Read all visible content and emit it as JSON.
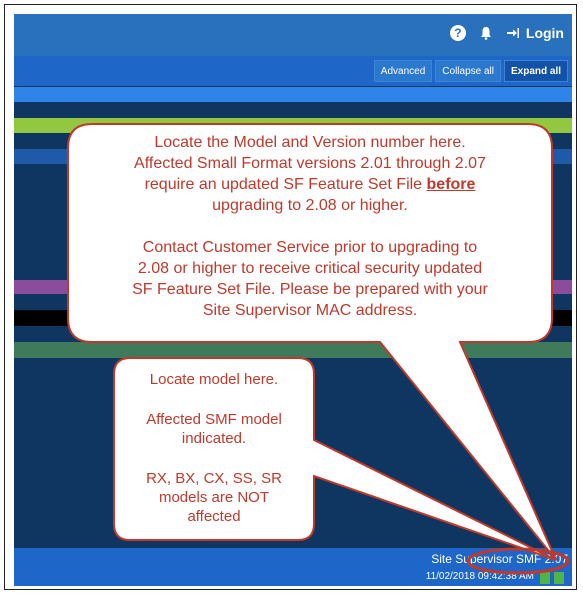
{
  "header": {
    "help_icon": "question-circle-icon",
    "bell_icon": "bell-icon",
    "login_label": "Login"
  },
  "toolbar": {
    "advanced_label": "Advanced",
    "collapse_label": "Collapse all",
    "expand_label": "Expand all"
  },
  "strips": {
    "colors": [
      "#2f84ea",
      "#91c83f",
      "#1e5aa8",
      "#8a4c9b",
      "#000000",
      "#3f7b5a"
    ]
  },
  "callout_main": {
    "line1": "Locate the Model and Version number here.",
    "line2": "Affected Small Format versions 2.01 through 2.07",
    "line3a": "require an updated SF Feature Set File ",
    "line3b": "before",
    "line4": "upgrading to 2.08 or higher.",
    "line5": "Contact  Customer Service prior to upgrading to",
    "line6": "2.08 or higher to receive critical security updated",
    "line7": "SF Feature Set File.  Please be prepared with your",
    "line8": "Site Supervisor MAC address."
  },
  "callout_small": {
    "line1": "Locate model here.",
    "line2": "Affected SMF model",
    "line3": "indicated.",
    "line4": "RX, BX, CX, SS, SR",
    "line5": "models are NOT",
    "line6": "affected"
  },
  "status": {
    "device_name": "Site Supervisor SMF 2.07",
    "timestamp": "11/02/2018 09:42:38 AM"
  },
  "colors": {
    "callout_border": "#c0392b",
    "callout_text": "#c0392b",
    "topbar": "#2a71bd",
    "background": "#0f3660"
  }
}
